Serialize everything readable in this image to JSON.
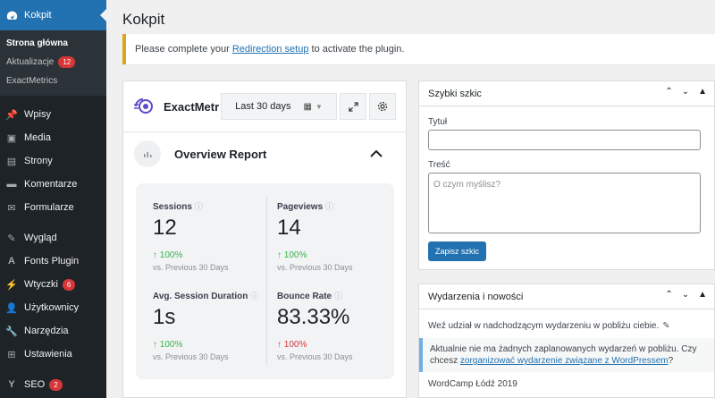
{
  "sidebar": {
    "dashboard": {
      "label": "Kokpit",
      "icon": "dashboard-icon"
    },
    "submenu": [
      {
        "label": "Strona główna",
        "current": true
      },
      {
        "label": "Aktualizacje",
        "badge": "12"
      },
      {
        "label": "ExactMetrics"
      }
    ],
    "items": [
      {
        "label": "Wpisy",
        "icon": "pin-icon"
      },
      {
        "label": "Media",
        "icon": "media-icon"
      },
      {
        "label": "Strony",
        "icon": "page-icon"
      },
      {
        "label": "Komentarze",
        "icon": "comment-icon"
      },
      {
        "label": "Formularze",
        "icon": "mail-icon"
      },
      {
        "label": "Wygląd",
        "icon": "brush-icon"
      },
      {
        "label": "Fonts Plugin",
        "icon": "font-icon"
      },
      {
        "label": "Wtyczki",
        "icon": "plugin-icon",
        "badge": "6"
      },
      {
        "label": "Użytkownicy",
        "icon": "users-icon"
      },
      {
        "label": "Narzędzia",
        "icon": "wrench-icon"
      },
      {
        "label": "Ustawienia",
        "icon": "settings-icon"
      },
      {
        "label": "SEO",
        "icon": "yoast-icon",
        "badge": "2"
      }
    ]
  },
  "page": {
    "title": "Kokpit",
    "notice_before": "Please complete your ",
    "notice_link": "Redirection setup",
    "notice_after": " to activate the plugin."
  },
  "exactmetrics": {
    "brand": "ExactMetrics",
    "date_range": "Last 30 days",
    "overview_title": "Overview Report",
    "stats": [
      {
        "label": "Sessions",
        "value": "12",
        "change": "100%",
        "direction": "up",
        "compare": "vs. Previous 30 Days"
      },
      {
        "label": "Pageviews",
        "value": "14",
        "change": "100%",
        "direction": "up",
        "compare": "vs. Previous 30 Days"
      },
      {
        "label": "Avg. Session Duration",
        "value": "1s",
        "change": "100%",
        "direction": "up",
        "compare": "vs. Previous 30 Days"
      },
      {
        "label": "Bounce Rate",
        "value": "83.33%",
        "change": "100%",
        "direction": "down",
        "compare": "vs. Previous 30 Days"
      }
    ]
  },
  "quick_draft": {
    "title": "Szybki szkic",
    "title_label": "Tytuł",
    "content_label": "Treść",
    "content_placeholder": "O czym myślisz?",
    "submit_label": "Zapisz szkic"
  },
  "events": {
    "title": "Wydarzenia i nowości",
    "intro": "Weź udział w nadchodzącym wydarzeniu w pobliżu ciebie.",
    "notice_line1": "Aktualnie nie ma żadnych zaplanowanych wydarzeń w pobliżu. Czy",
    "notice_line2_before": "chcesz ",
    "notice_link": "zorganizować wydarzenie związane z WordPressem",
    "notice_line2_after": "?",
    "item": "WordCamp Łódź 2019"
  },
  "colors": {
    "sidebar_bg": "#1d2327",
    "accent": "#2271b1",
    "badge": "#d63638",
    "up": "#39b54a",
    "down": "#d73638"
  }
}
